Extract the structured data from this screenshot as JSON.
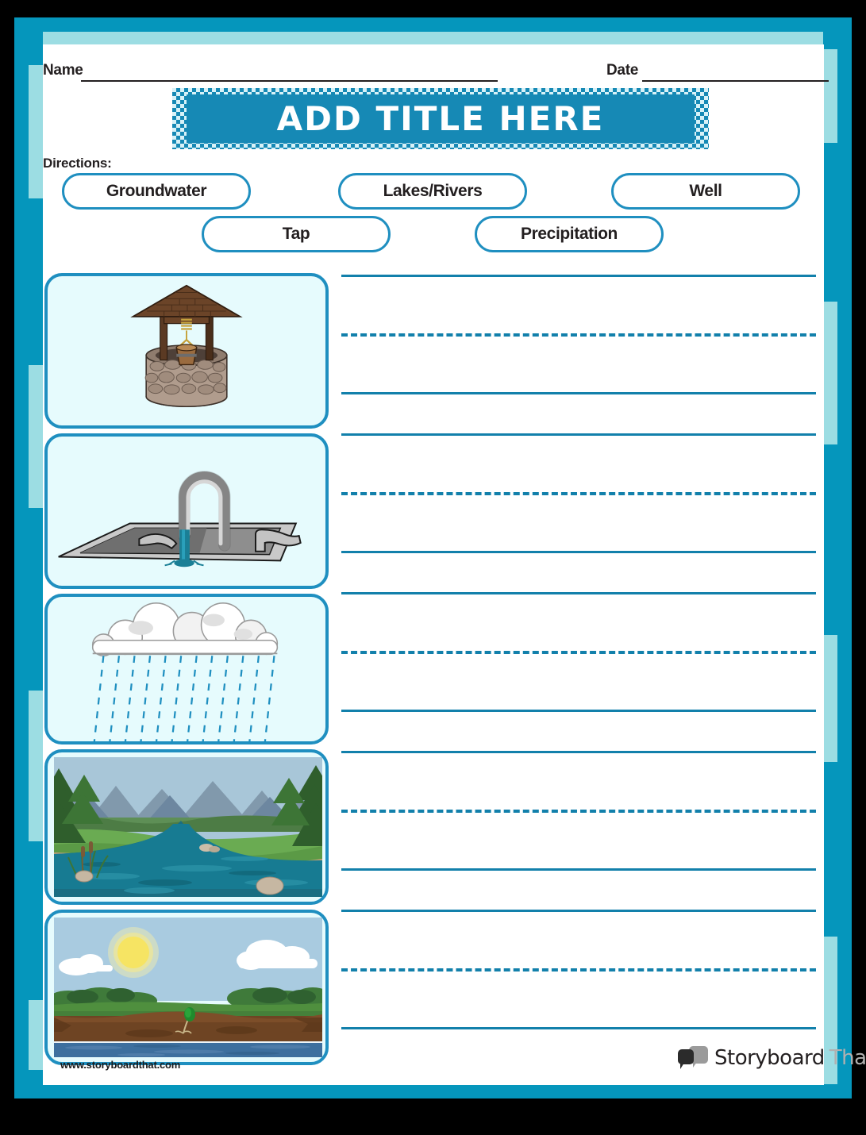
{
  "meta": {
    "colors": {
      "frame_teal": "#0596bc",
      "frame_light": "#9cdde3",
      "accent_blue": "#1689b5",
      "chip_border": "#1f8fc0",
      "card_fill": "#e6fbfd",
      "rule_blue": "#1280ab",
      "ink": "#231f20"
    }
  },
  "header": {
    "name_label": "Name",
    "date_label": "Date",
    "title": "ADD TITLE HERE",
    "directions_label": "Directions:"
  },
  "word_bank": {
    "items": [
      {
        "label": "Groundwater"
      },
      {
        "label": "Lakes/Rivers"
      },
      {
        "label": "Well"
      },
      {
        "label": "Tap"
      },
      {
        "label": "Precipitation"
      }
    ]
  },
  "cards": [
    {
      "art": "well-illustration",
      "alt": "Stone well with wooden roof and bucket"
    },
    {
      "art": "tap-faucet-illustration",
      "alt": "Kitchen sink faucet with running water"
    },
    {
      "art": "precipitation-illustration",
      "alt": "Rain cloud with falling rain"
    },
    {
      "art": "river-photo",
      "alt": "River winding through mountains and forest"
    },
    {
      "art": "groundwater-photo",
      "alt": "Cross-section of ground with water table below soil"
    }
  ],
  "writing_area": {
    "line_groups": 5,
    "lines_per_group": 3,
    "pattern": [
      "solid",
      "dashed",
      "solid"
    ]
  },
  "footer": {
    "url": "www.storyboardthat.com",
    "logo_primary": "Storyboard",
    "logo_secondary": "That"
  }
}
